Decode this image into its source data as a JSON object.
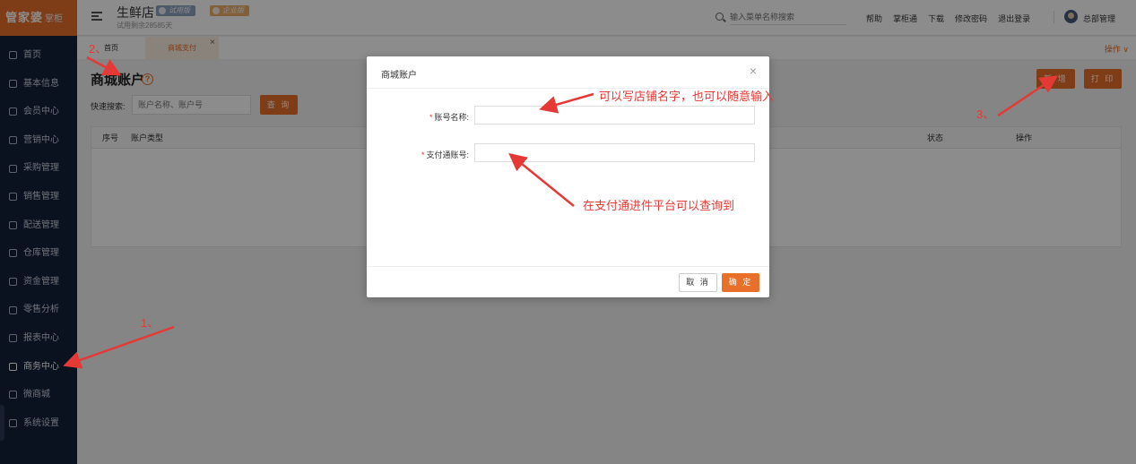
{
  "sidebar": {
    "logo": "管家婆",
    "logo_sub": "掌柜",
    "items": [
      {
        "label": "首页",
        "icon": "gear-icon"
      },
      {
        "label": "基本信息",
        "icon": "home-icon"
      },
      {
        "label": "会员中心",
        "icon": "member-icon"
      },
      {
        "label": "营销中心",
        "icon": "gift-icon"
      },
      {
        "label": "采购管理",
        "icon": "cart-icon"
      },
      {
        "label": "销售管理",
        "icon": "sales-icon"
      },
      {
        "label": "配送管理",
        "icon": "truck-icon"
      },
      {
        "label": "仓库管理",
        "icon": "warehouse-icon"
      },
      {
        "label": "资金管理",
        "icon": "fund-icon"
      },
      {
        "label": "零售分析",
        "icon": "chart-icon"
      },
      {
        "label": "报表中心",
        "icon": "report-icon"
      },
      {
        "label": "商务中心",
        "icon": "business-icon",
        "active": true
      },
      {
        "label": "微商城",
        "icon": "bag-icon"
      },
      {
        "label": "系统设置",
        "icon": "settings-icon"
      }
    ]
  },
  "header": {
    "store_name": "生鲜店",
    "trial_text": "试用剩余28585天",
    "badge_trial": "试用版",
    "badge_edition": "企业版",
    "search_placeholder": "输入菜单名称搜索",
    "links": [
      "帮助",
      "掌柜通",
      "下载",
      "修改密码",
      "退出登录"
    ],
    "admin": "总部管理"
  },
  "tabs": {
    "home": "首页",
    "active": "商城支付",
    "close": "×",
    "op_menu": "操作 ∨"
  },
  "main": {
    "title": "商城账户",
    "help": "?",
    "quick_search_label": "快速搜索:",
    "quick_search_placeholder": "账户名称、账户号",
    "query_button": "查 询",
    "add_button": "新 增",
    "print_button": "打 印",
    "columns": [
      "序号",
      "账户类型",
      "状态",
      "操作"
    ]
  },
  "modal": {
    "title": "商城账户",
    "close": "×",
    "field1_label": "账号名称:",
    "field2_label": "支付通账号:",
    "required_mark": "*",
    "cancel": "取 消",
    "confirm": "确 定"
  },
  "annotations": {
    "step1": "1、",
    "step2": "2、",
    "step3": "3、",
    "note1": "可以写店铺名字，也可以随意输入",
    "note2": "在支付通进件平台可以查询到"
  },
  "colors": {
    "accent": "#e8702a",
    "sidebar_bg": "#13203a",
    "annotation": "#e53935"
  }
}
